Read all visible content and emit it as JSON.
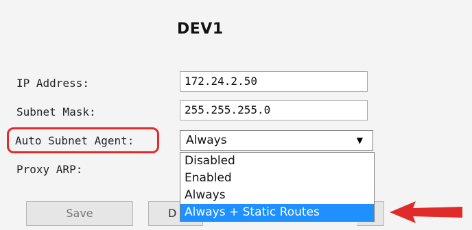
{
  "device": {
    "title": "DEV1"
  },
  "fields": {
    "ip_address": {
      "label": "IP Address:",
      "value": "172.24.2.50"
    },
    "subnet_mask": {
      "label": "Subnet Mask:",
      "value": "255.255.255.0"
    },
    "auto_subnet_agent": {
      "label": "Auto Subnet Agent:",
      "selected": "Always",
      "options": [
        "Disabled",
        "Enabled",
        "Always",
        "Always + Static Routes"
      ],
      "highlighted_option": "Always + Static Routes"
    },
    "proxy_arp": {
      "label": "Proxy ARP:"
    }
  },
  "buttons": {
    "save": "Save",
    "second_partial": "D"
  },
  "colors": {
    "annotation_red": "#e12b2b",
    "option_highlight": "#1e90ff"
  },
  "icons": {
    "dropdown_arrow": "▼"
  }
}
